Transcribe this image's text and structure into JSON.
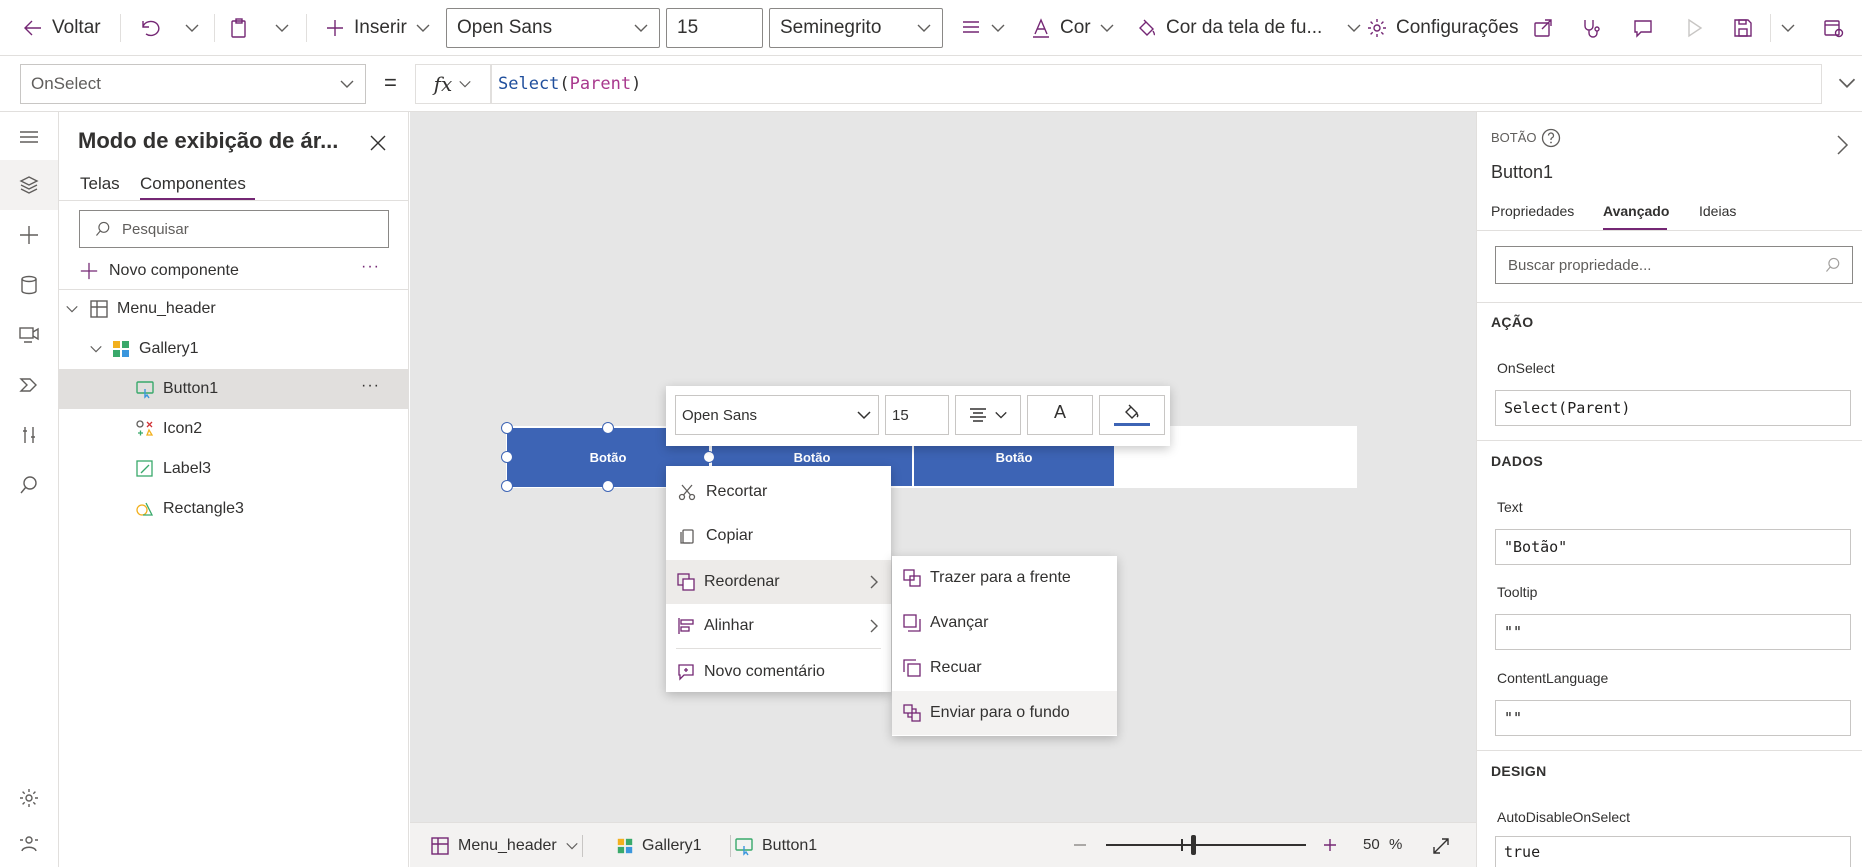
{
  "toolbar": {
    "back_label": "Voltar",
    "insert_label": "Inserir",
    "font_name": "Open Sans",
    "font_size": "15",
    "font_weight": "Seminegrito",
    "color_label": "Cor",
    "screen_color_label": "Cor da tela de fu...",
    "settings_label": "Configurações"
  },
  "formula": {
    "property": "OnSelect",
    "equals": "=",
    "fx": "fx",
    "fn": "Select",
    "open_paren": "(",
    "arg": "Parent",
    "close_paren": ")"
  },
  "tree": {
    "title": "Modo de exibição de ár...",
    "tabs": [
      "Telas",
      "Componentes"
    ],
    "active_tab": "Componentes",
    "search_placeholder": "Pesquisar",
    "new_component": "Novo componente",
    "items": [
      {
        "label": "Menu_header",
        "icon": "component-icon"
      },
      {
        "label": "Gallery1",
        "icon": "gallery-icon"
      },
      {
        "label": "Button1",
        "icon": "button-icon"
      },
      {
        "label": "Icon2",
        "icon": "icons-icon"
      },
      {
        "label": "Label3",
        "icon": "label-icon"
      },
      {
        "label": "Rectangle3",
        "icon": "shapes-icon"
      }
    ]
  },
  "canvas": {
    "buttons": [
      "Botão",
      "Botão",
      "Botão"
    ],
    "float_toolbar": {
      "font": "Open Sans",
      "size": "15",
      "font_color_glyph": "A"
    },
    "context_menu": [
      "Recortar",
      "Copiar",
      "Reordenar",
      "Alinhar",
      "Novo comentário"
    ],
    "submenu": [
      "Trazer para a frente",
      "Avançar",
      "Recuar",
      "Enviar para o fundo"
    ]
  },
  "bottombar": {
    "crumbs": [
      "Menu_header",
      "Gallery1",
      "Button1"
    ],
    "zoom_value": "50",
    "zoom_unit": "%",
    "zoom_level": 0.5
  },
  "props": {
    "type_label": "BOTÃO",
    "control_name": "Button1",
    "tabs": [
      "Propriedades",
      "Avançado",
      "Ideias"
    ],
    "active_tab": "Avançado",
    "search_placeholder": "Buscar propriedade...",
    "sections": {
      "action": "AÇÃO",
      "data": "DADOS",
      "design": "DESIGN"
    },
    "fields": {
      "onselect_label": "OnSelect",
      "onselect_value": "Select(Parent)",
      "text_label": "Text",
      "text_value": "\"Botão\"",
      "tooltip_label": "Tooltip",
      "tooltip_value": "\"\"",
      "contentlanguage_label": "ContentLanguage",
      "contentlanguage_value": "\"\"",
      "autodisable_label": "AutoDisableOnSelect",
      "autodisable_value": "true"
    }
  },
  "colors": {
    "accent": "#742774",
    "button_blue": "#3d64b5",
    "canvas_bg": "#e6e6e6"
  }
}
